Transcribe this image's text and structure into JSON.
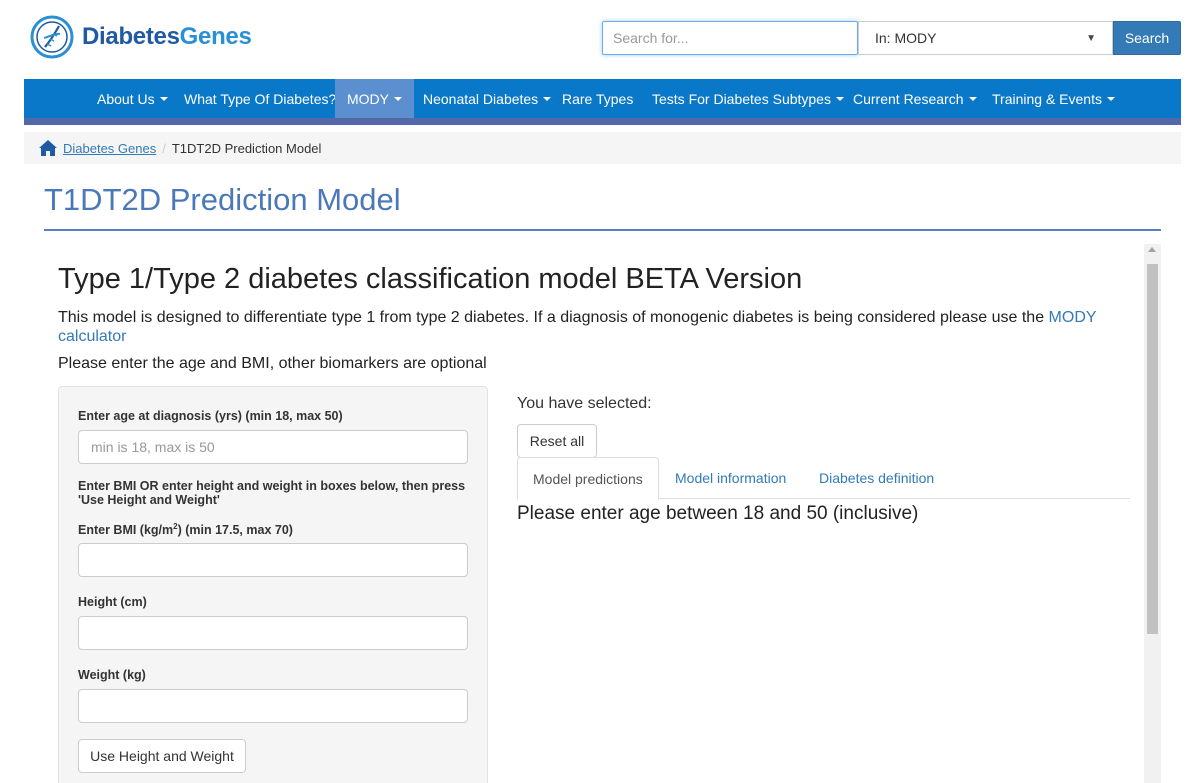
{
  "brand": {
    "part1": "Diabetes",
    "part2": "Genes",
    "logo_icon": "dna-helix-logo"
  },
  "search": {
    "placeholder": "Search for...",
    "scope": "In: MODY",
    "button": "Search"
  },
  "nav": [
    {
      "label": "About Us",
      "caret": true
    },
    {
      "label": "What Type Of Diabetes?",
      "caret": false
    },
    {
      "label": "MODY",
      "caret": true,
      "active": true
    },
    {
      "label": "Neonatal Diabetes",
      "caret": true
    },
    {
      "label": "Rare Types",
      "caret": false
    },
    {
      "label": "Tests For Diabetes Subtypes",
      "caret": true
    },
    {
      "label": "Current Research",
      "caret": true
    },
    {
      "label": "Training & Events",
      "caret": true
    }
  ],
  "breadcrumb": {
    "home": "Diabetes Genes",
    "separator": "/",
    "current": "T1DT2D Prediction Model"
  },
  "page_title": "T1DT2D Prediction Model",
  "app": {
    "heading": "Type 1/Type 2 diabetes classification model BETA Version",
    "desc_text": "This model is designed to differentiate type 1 from type 2 diabetes. If a diagnosis of monogenic diabetes is being considered please use the ",
    "desc_link": "MODY calculator",
    "instructions": "Please enter the age and BMI, other biomarkers are optional",
    "form": {
      "age_label": "Enter age at diagnosis (yrs) (min 18, max 50)",
      "age_placeholder": "min is 18, max is 50",
      "bmi_note": "Enter BMI OR enter height and weight in boxes below, then press 'Use Height and Weight'",
      "bmi_label_pre": "Enter BMI (kg/m",
      "bmi_label_sup": "2",
      "bmi_label_post": ") (min 17.5, max 70)",
      "height_label": "Height (cm)",
      "weight_label": "Weight (kg)",
      "use_hw_button": "Use Height and Weight"
    },
    "selected_label": "You have selected:",
    "reset_button": "Reset all",
    "tabs": [
      "Model predictions",
      "Model information",
      "Diabetes definition"
    ],
    "active_tab": "Model predictions",
    "result_text": "Please enter age between 18 and 50 (inclusive)"
  },
  "colors": {
    "nav_bg": "#0a78c9",
    "nav_active": "#5b8fd0",
    "link": "#337ab7",
    "title": "#4a78b8"
  }
}
